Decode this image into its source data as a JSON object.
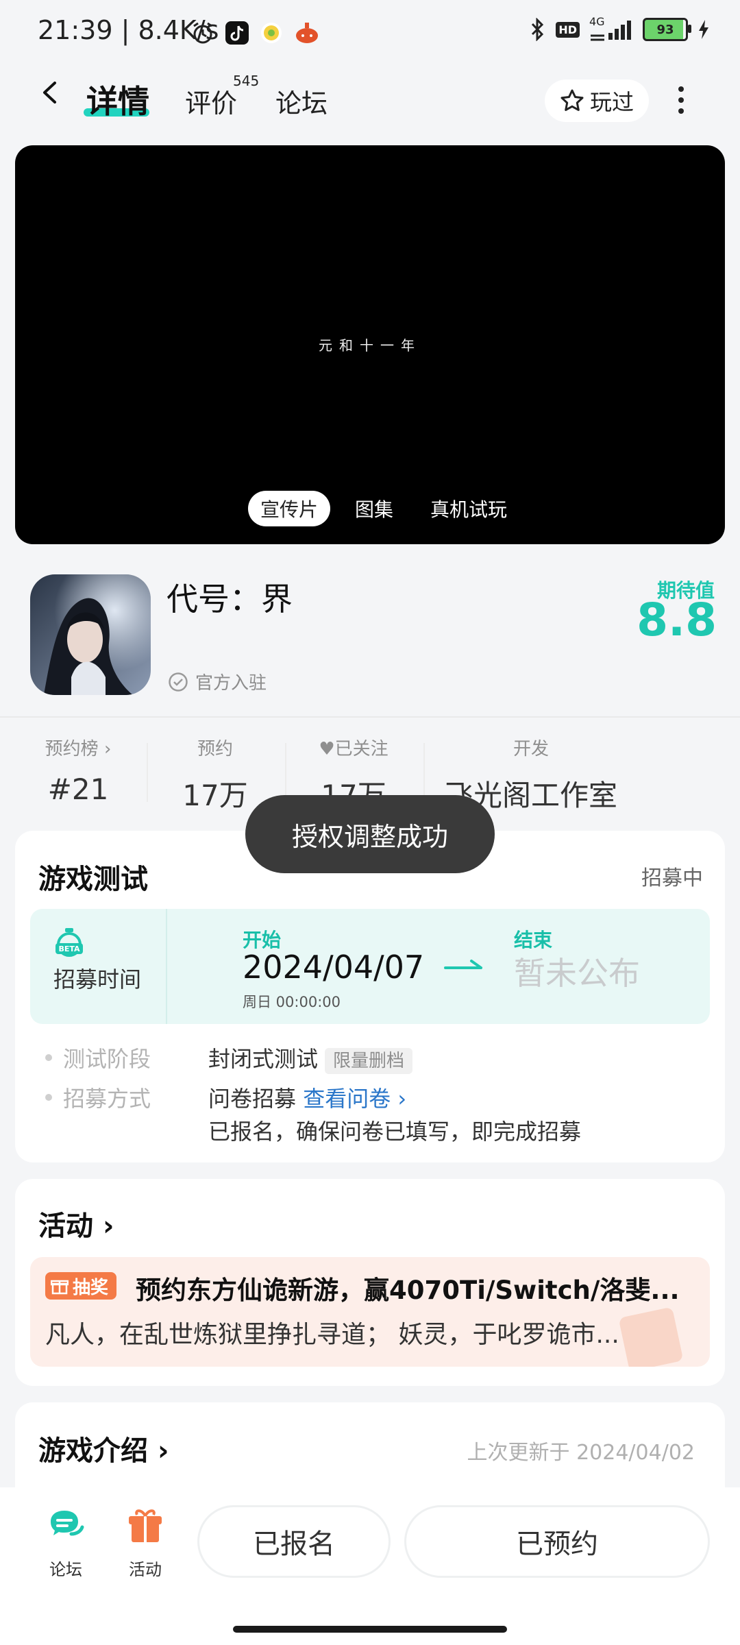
{
  "status_bar": {
    "time": "21:39 | 8.4K/s",
    "hd": "HD",
    "network": "4G",
    "battery": "93"
  },
  "nav": {
    "tab_detail": "详情",
    "tab_review": "评价",
    "review_count": "545",
    "tab_forum": "论坛",
    "played_label": "玩过"
  },
  "video": {
    "caption": "元和十一年",
    "tabs": [
      "宣传片",
      "图集",
      "真机试玩"
    ]
  },
  "game": {
    "title": "代号：界",
    "official_label": "官方入驻",
    "expect_label": "期待值",
    "expect_value": "8.8"
  },
  "stats": [
    {
      "label": "预约榜",
      "value": "#21"
    },
    {
      "label": "预约",
      "value": "17万"
    },
    {
      "label": "已关注",
      "value": "17万"
    },
    {
      "label": "开发",
      "value": "飞光阁工作室"
    }
  ],
  "toast": "授权调整成功",
  "test_card": {
    "title": "游戏测试",
    "status": "招募中",
    "recruit_label": "招募时间",
    "start_label": "开始",
    "start_date": "2024/04/07",
    "start_time": "周日  00:00:00",
    "end_label": "结束",
    "end_value": "暂未公布",
    "phase_label": "测试阶段",
    "phase_value": "封闭式测试",
    "phase_tag": "限量删档",
    "method_label": "招募方式",
    "method_value": "问卷招募",
    "method_link": "查看问卷",
    "method_note": "已报名，确保问卷已填写，即完成招募"
  },
  "activity_card": {
    "title": "活动",
    "badge": "抽奖",
    "headline": "预约东方仙诡新游，赢4070Ti/Switch/洛斐...",
    "desc": "凡人，在乱世炼狱里挣扎寻道；  妖灵，于叱罗诡市..."
  },
  "intro_card": {
    "title": "游戏介绍",
    "updated": "上次更新于 2024/04/02"
  },
  "bottom": {
    "forum_label": "论坛",
    "activity_label": "活动",
    "signed_up": "已报名",
    "reserved": "已预约"
  },
  "colors": {
    "accent": "#1fc7b0",
    "link": "#2a76c9",
    "lottery": "#f47a46"
  }
}
